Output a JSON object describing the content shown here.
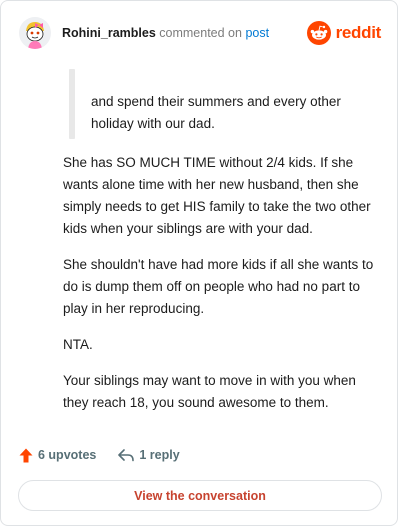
{
  "header": {
    "username": "Rohini_rambles",
    "commented_text": "commented on",
    "post_link": "post",
    "brand_wordmark": "reddit",
    "avatar_icon": "snoo-avatar-icon",
    "brand_icon": "reddit-logo-icon"
  },
  "quote": {
    "text": "and spend their summers and every other holiday with our dad."
  },
  "comment": {
    "paragraphs": [
      "She has SO MUCH TIME without 2/4 kids. If she wants alone time with her new husband, then she simply needs to get HIS family to take the two other kids when your siblings are with your dad.",
      "She shouldn't have had more kids if all she wants to do is dump them off on people who had no part to play in her reproducing.",
      "NTA.",
      "Your siblings may want to move in with you when they reach 18, you sound awesome to them."
    ]
  },
  "actions": {
    "upvotes_label": "6 upvotes",
    "replies_label": "1 reply",
    "upvote_icon": "upvote-arrow-icon",
    "reply_icon": "reply-arrow-icon"
  },
  "cta": {
    "label": "View the conversation"
  },
  "colors": {
    "brand": "#ff4500",
    "link": "#0079d3",
    "cta_text": "#c7432f",
    "upvote": "#ff4500",
    "muted": "#576f76"
  }
}
